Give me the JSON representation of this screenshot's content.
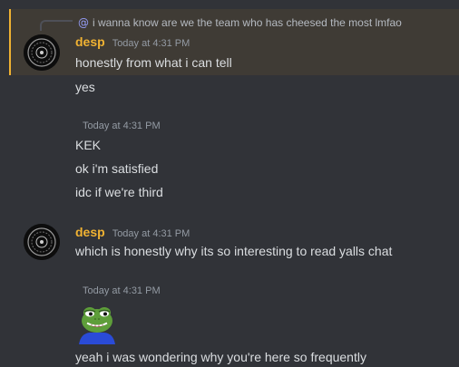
{
  "reply": {
    "mention": "@",
    "text": "i wanna know are we the team who has cheesed the most lmfao"
  },
  "messages": {
    "group1": {
      "username": "desp",
      "timestamp": "Today at 4:31 PM",
      "lines": [
        "honestly from what i can tell",
        "yes"
      ]
    },
    "group2": {
      "timestamp": "Today at 4:31 PM",
      "lines": [
        "KEK",
        "ok i'm satisfied",
        "idc if we're third"
      ]
    },
    "group3": {
      "username": "desp",
      "timestamp": "Today at 4:31 PM",
      "lines": [
        "which is honestly why its so interesting to read yalls chat"
      ]
    },
    "group4": {
      "timestamp": "Today at 4:31 PM",
      "emoji": "pepe-frog-emoji",
      "lines": [
        "yeah i was wondering why you're here so frequently"
      ]
    }
  },
  "colors": {
    "background": "#313338",
    "highlight": "#3f3b35",
    "highlight_border": "#f0b232",
    "username": "#f0b232",
    "timestamp": "#949ba4",
    "text": "#dbdee1",
    "mention": "#949cf7"
  }
}
